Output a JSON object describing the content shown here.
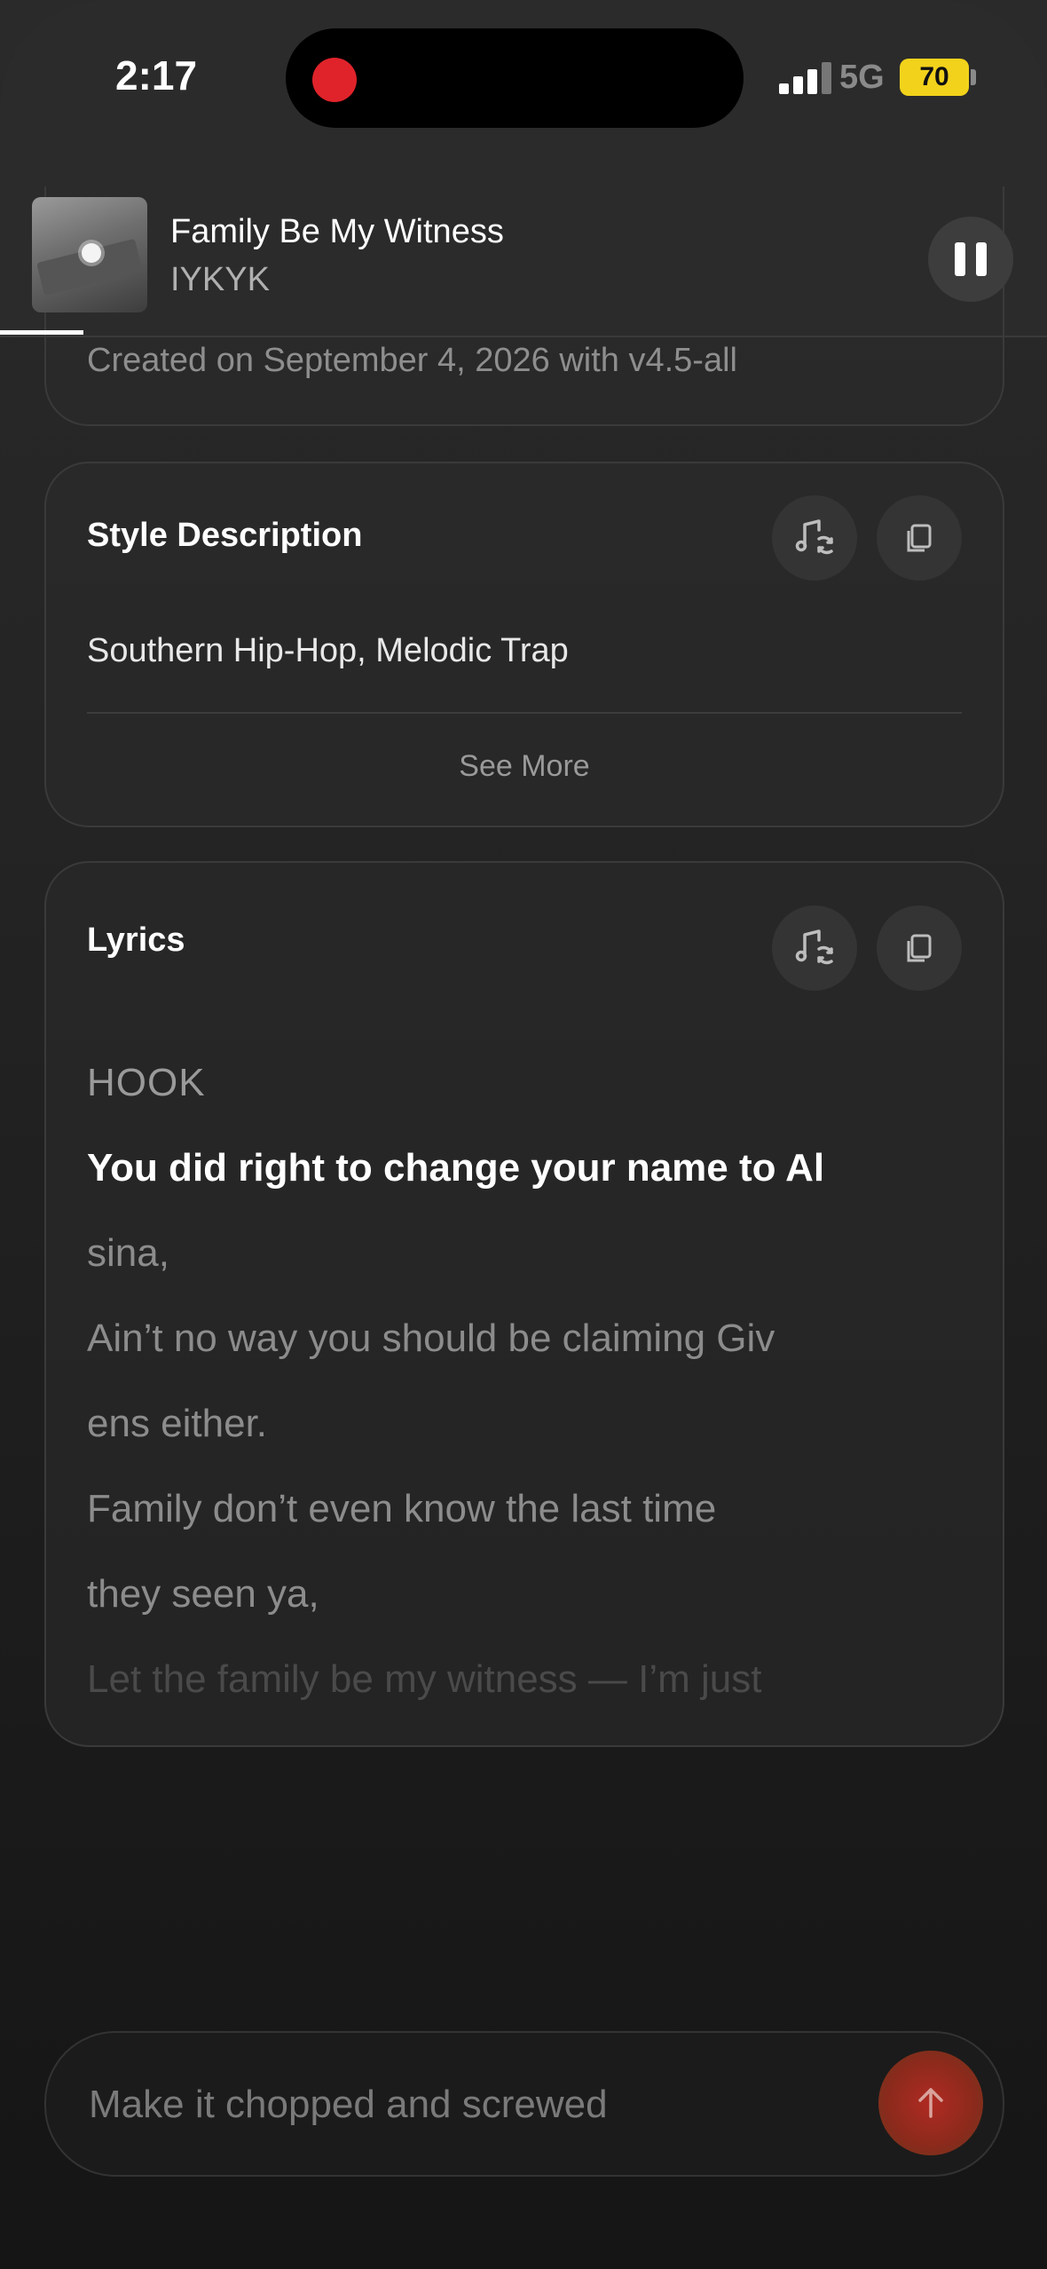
{
  "status_bar": {
    "time": "2:17",
    "network": "5G",
    "battery": "70",
    "recording": true
  },
  "now_playing": {
    "title": "Family Be My Witness",
    "artist": "IYKYK",
    "progress": 0.08,
    "pause_icon": "pause-icon"
  },
  "info_card": {
    "created": "Created on September 4, 2026 with v4.5-all"
  },
  "style_card": {
    "title": "Style Description",
    "description": "Southern Hip-Hop, Melodic Trap",
    "see_more": "See More",
    "remix_icon": "music-remix-icon",
    "copy_icon": "copy-icon"
  },
  "lyrics_card": {
    "title": "Lyrics",
    "lines": [
      "HOOK",
      "You did right to change your name to Al",
      "sina,",
      "Ain’t no way you should be claiming Giv",
      "ens either.",
      "Family don’t even know the last time",
      "they seen ya,",
      "Let the family be my witness — I’m just"
    ]
  },
  "prompt": {
    "placeholder": "Make it chopped and screwed",
    "send_icon": "arrow-up-icon"
  },
  "colors": {
    "accent": "#b02a22",
    "battery": "#f2d21b",
    "record": "#e0232b"
  }
}
